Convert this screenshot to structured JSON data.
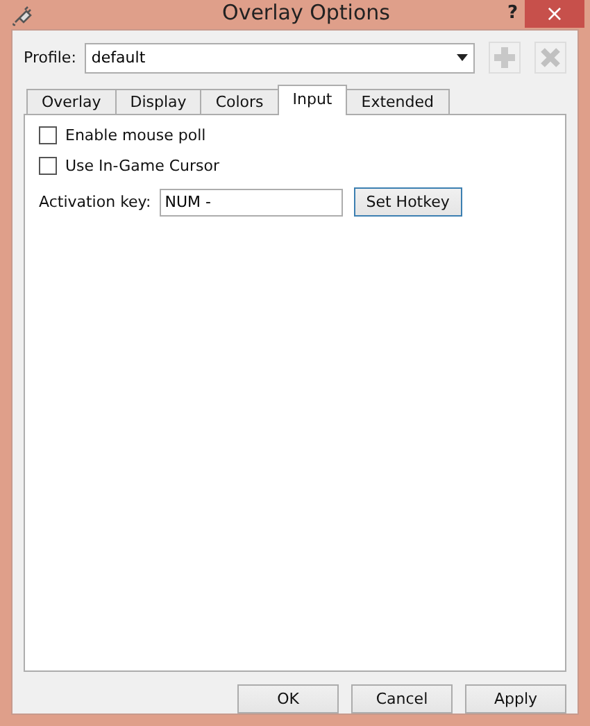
{
  "window": {
    "title": "Overlay Options",
    "help": "?",
    "close": "×"
  },
  "profile": {
    "label": "Profile:",
    "value": "default"
  },
  "tabs": [
    {
      "label": "Overlay",
      "selected": false
    },
    {
      "label": "Display",
      "selected": false
    },
    {
      "label": "Colors",
      "selected": false
    },
    {
      "label": "Input",
      "selected": true
    },
    {
      "label": "Extended",
      "selected": false
    }
  ],
  "options": [
    {
      "label": "Enable mouse poll",
      "checked": false
    },
    {
      "label": "Use In-Game Cursor",
      "checked": false
    }
  ],
  "activation": {
    "label": "Activation key:",
    "value": "NUM -",
    "button": "Set Hotkey"
  },
  "buttons": [
    "OK",
    "Cancel",
    "Apply"
  ]
}
